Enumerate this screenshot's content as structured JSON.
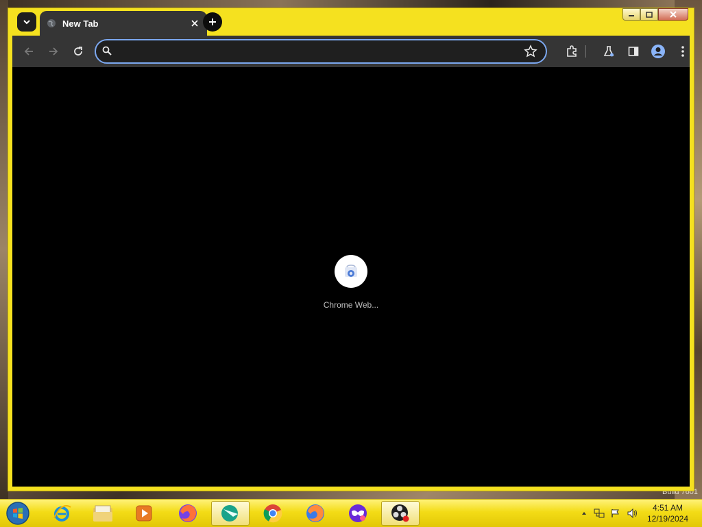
{
  "browser": {
    "tabs": [
      {
        "title": "New Tab",
        "active": true
      }
    ],
    "omnibox": {
      "value": "",
      "placeholder": ""
    },
    "window_controls": [
      "minimize",
      "maximize",
      "close"
    ],
    "toolbar_icons": [
      "back-icon",
      "forward-icon",
      "reload-icon",
      "bookmark-star-icon",
      "extensions-icon",
      "labs-flask-icon",
      "side-panel-icon",
      "profile-avatar-icon",
      "more-menu-icon"
    ]
  },
  "new_tab_page": {
    "shortcuts": [
      {
        "label": "Chrome Web..."
      }
    ]
  },
  "desktop": {
    "build_text": "Build 7601"
  },
  "taskbar": {
    "pinned": [
      "internet-explorer-icon",
      "file-explorer-icon",
      "media-player-icon",
      "firefox-icon",
      "app-teal-icon",
      "chrome-icon",
      "firefox-icon",
      "mask-app-icon",
      "obs-icon"
    ],
    "clock": {
      "time": "4:51 AM",
      "date": "12/19/2024"
    }
  },
  "colors": {
    "theme_yellow": "#f5e11f",
    "toolbar_dark": "#353535",
    "omnibox_border": "#7ca8f0",
    "content_black": "#000000"
  }
}
